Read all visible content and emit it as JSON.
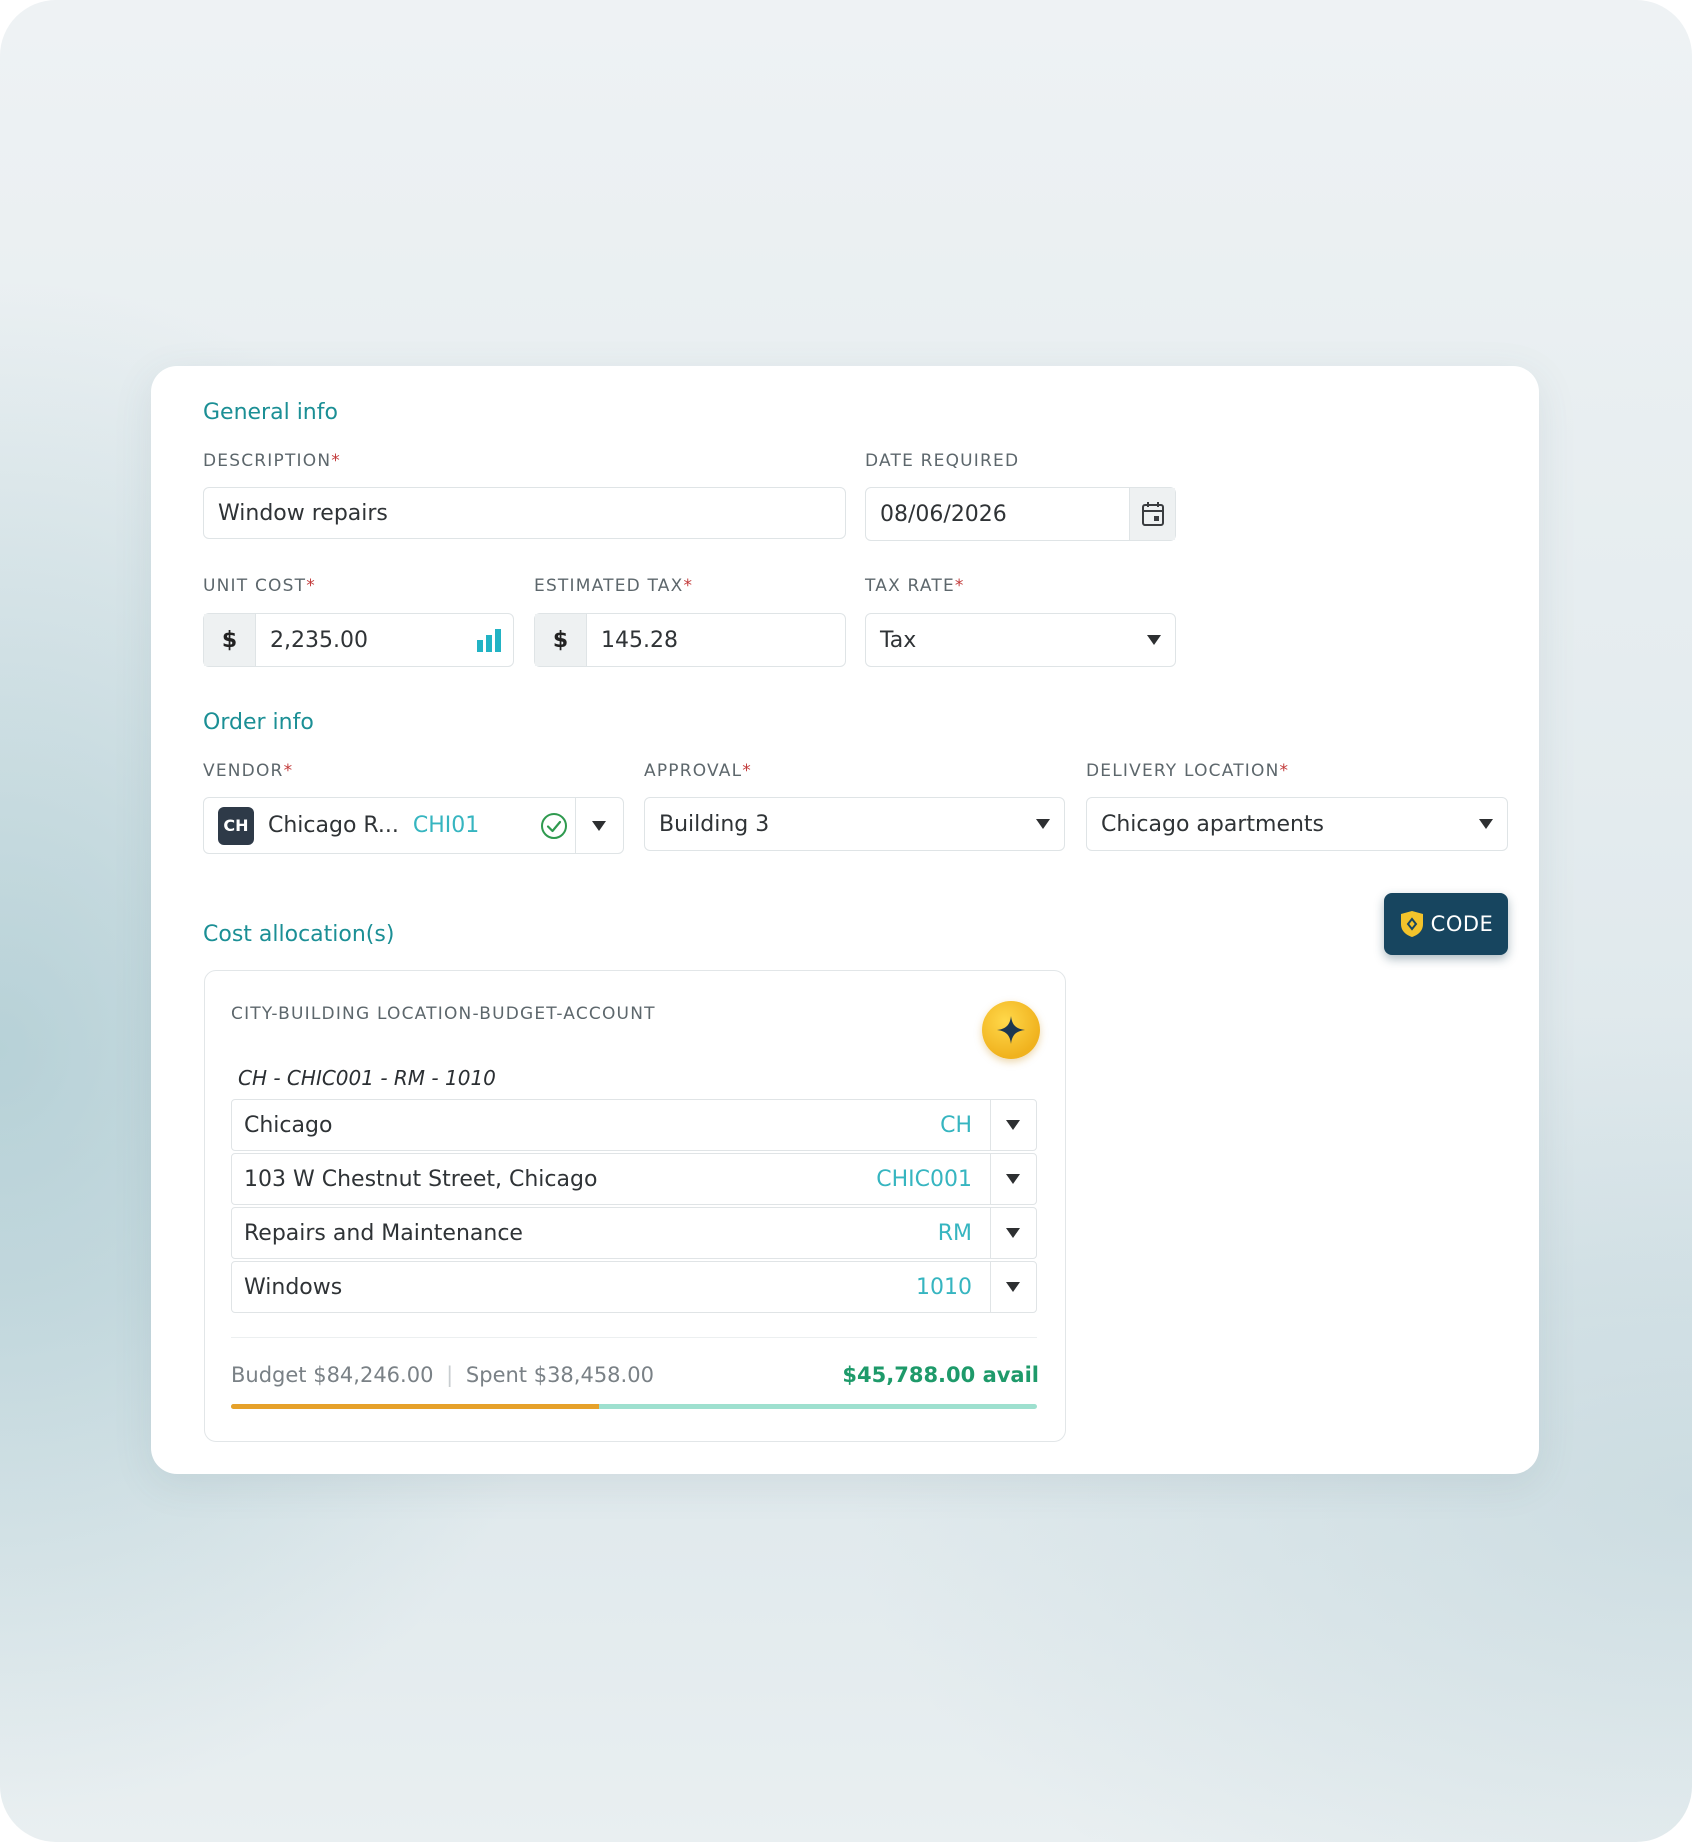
{
  "colors": {
    "accent_teal": "#1b8f95",
    "code_teal": "#36b5c0",
    "required_red": "#c23a3a",
    "spent_bar": "#e6a12a",
    "avail_bar": "#9ee0cf",
    "avail_text": "#1e9a6a",
    "code_button": "#17455f"
  },
  "general_info": {
    "title": "General info",
    "description": {
      "label": "DESCRIPTION",
      "required": "*",
      "value": "Window repairs"
    },
    "date_required": {
      "label": "DATE REQUIRED",
      "value": "08/06/2026",
      "icon": "calendar-icon"
    },
    "unit_cost": {
      "label": "UNIT COST",
      "required": "*",
      "prefix": "$",
      "value": "2,235.00",
      "icon": "bar-chart-icon"
    },
    "estimated_tax": {
      "label": "ESTIMATED TAX",
      "required": "*",
      "prefix": "$",
      "value": "145.28"
    },
    "tax_rate": {
      "label": "TAX RATE",
      "required": "*",
      "value": "Tax"
    }
  },
  "order_info": {
    "title": "Order info",
    "vendor": {
      "label": "VENDOR",
      "required": "*",
      "avatar": "CH",
      "name": "Chicago R...",
      "code": "CHI01",
      "icon": "check-circle-icon"
    },
    "approval": {
      "label": "APPROVAL",
      "required": "*",
      "value": "Building 3"
    },
    "delivery_location": {
      "label": "DELIVERY LOCATION",
      "required": "*",
      "value": "Chicago apartments"
    }
  },
  "code_button": {
    "label": "CODE",
    "icon": "shield-icon"
  },
  "cost_allocation": {
    "title": "Cost allocation(s)",
    "header": "CITY-BUILDING LOCATION-BUDGET-ACCOUNT",
    "combined_code": "CH - CHIC001 - RM - 1010",
    "ai_button_icon": "sparkle-icon",
    "segments": [
      {
        "name": "Chicago",
        "code": "CH"
      },
      {
        "name": "103 W Chestnut Street, Chicago",
        "code": "CHIC001"
      },
      {
        "name": "Repairs and Maintenance",
        "code": "RM"
      },
      {
        "name": "Windows",
        "code": "1010"
      }
    ],
    "budget": "Budget $84,246.00",
    "separator": "|",
    "spent": "Spent $38,458.00",
    "available": "$45,788.00 avail",
    "spent_fraction": 0.4565
  }
}
